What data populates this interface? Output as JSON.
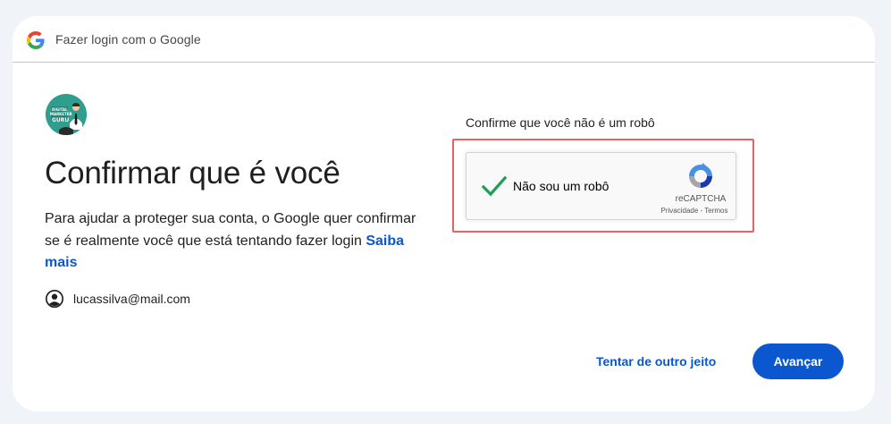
{
  "header": {
    "title": "Fazer login com o Google",
    "logo_icon": "google-g-icon"
  },
  "brand_badge": {
    "icon": "digital-marketer-guru-logo",
    "text_lines": [
      "DIGITAL",
      "MARKETER",
      "GURU"
    ]
  },
  "main": {
    "heading": "Confirmar que é você",
    "description": "Para ajudar a proteger sua conta, o Google quer confirmar se é realmente você que está tentando fazer login",
    "learn_more_link": "Saiba mais",
    "account": {
      "icon": "account-circle-icon",
      "email": "lucassilva@mail.com"
    }
  },
  "captcha": {
    "prompt": "Confirme que você não é um robô",
    "checkbox_label": "Não sou um robô",
    "checked": true,
    "brand": "reCAPTCHA",
    "privacy_link": "Privacidade",
    "separator": " - ",
    "terms_link": "Termos",
    "highlight_color": "#e86265"
  },
  "actions": {
    "try_another_way": "Tentar de outro jeito",
    "next": "Avançar"
  },
  "colors": {
    "accent": "#0b57d0",
    "check": "#1e9e55",
    "background": "#f0f4f9",
    "card": "#ffffff"
  }
}
